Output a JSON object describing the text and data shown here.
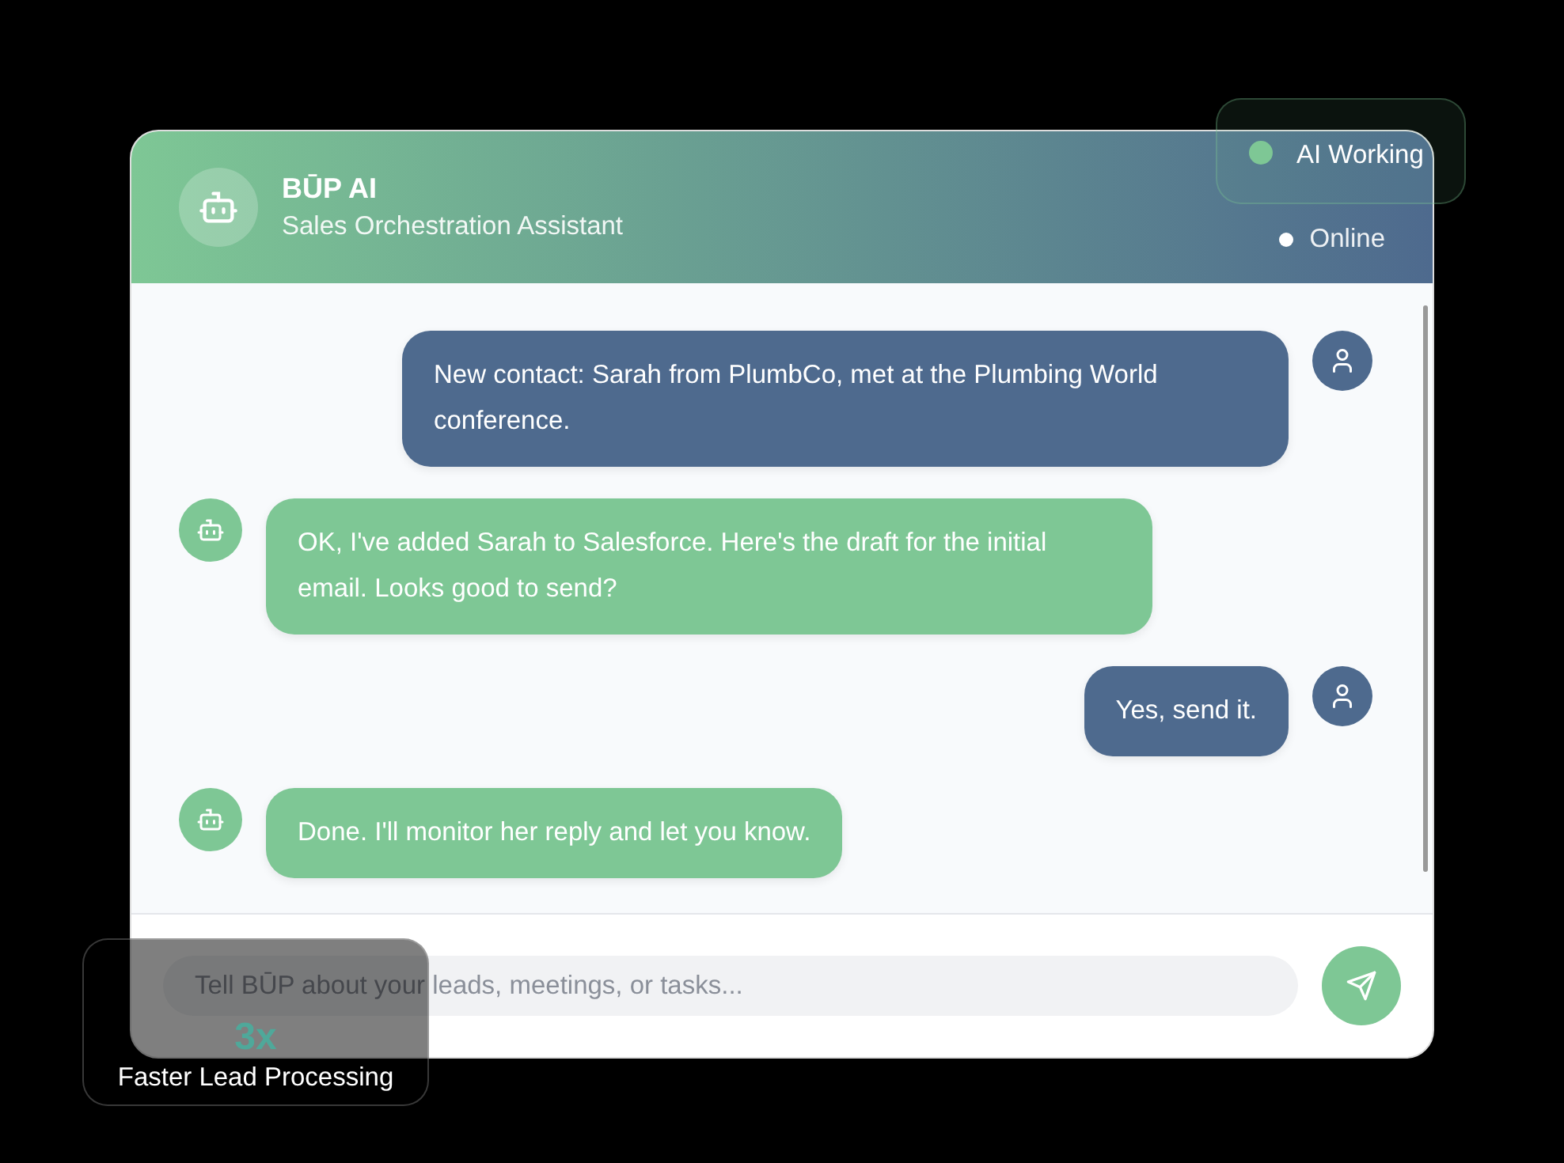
{
  "header": {
    "title": "BŪP AI",
    "subtitle": "Sales Orchestration Assistant",
    "status": "Online"
  },
  "messages": [
    {
      "kind": "user",
      "text": "New contact: Sarah from PlumbCo, met at the Plumbing World conference."
    },
    {
      "kind": "bot",
      "text": "OK, I've added Sarah to Salesforce. Here's the draft for the initial email. Looks good to send?"
    },
    {
      "kind": "user",
      "text": "Yes, send it."
    },
    {
      "kind": "bot",
      "text": "Done. I'll monitor her reply and let you know."
    }
  ],
  "input": {
    "placeholder": "Tell BŪP about your leads, meetings, or tasks..."
  },
  "ai_badge": {
    "label": "AI Working"
  },
  "stat_card": {
    "value": "3x",
    "label": "Faster Lead Processing"
  }
}
